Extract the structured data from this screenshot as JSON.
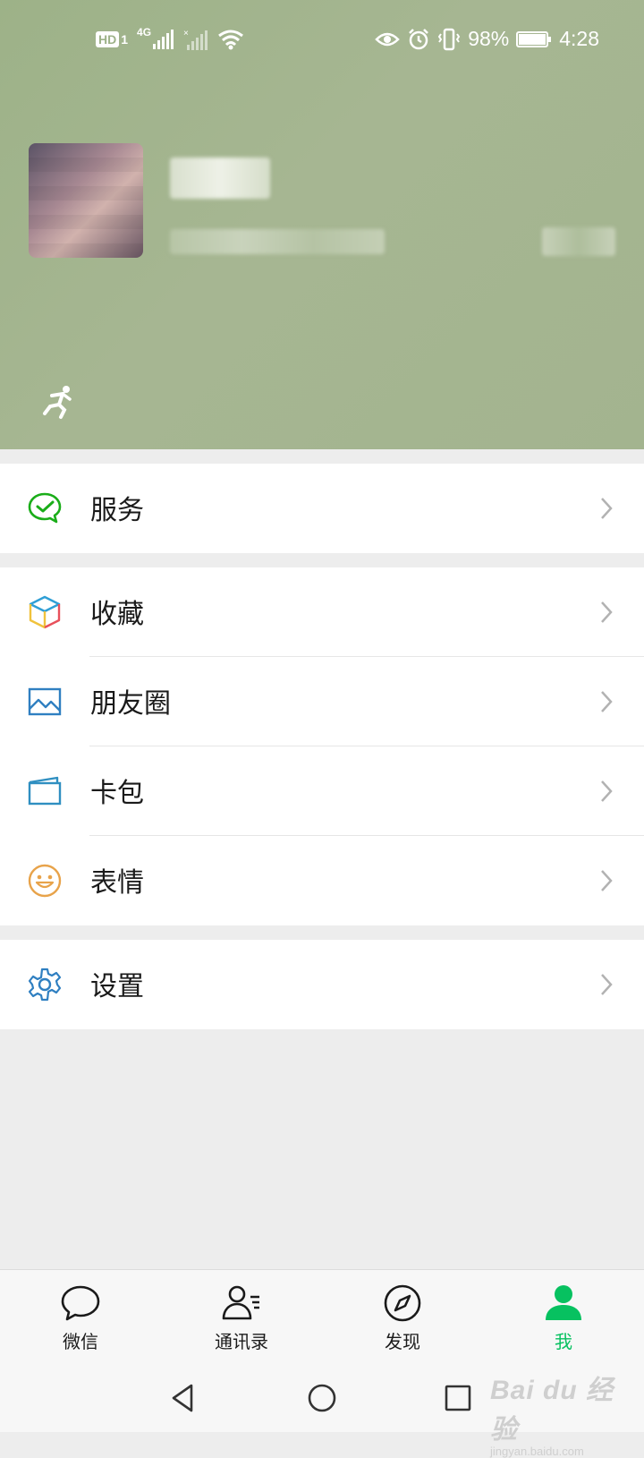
{
  "status_bar": {
    "hd_badge": "HD",
    "sim_slot": "1",
    "network": "4G",
    "battery_percent": "98%",
    "time": "4:28",
    "icons": [
      "eye-icon",
      "alarm-icon",
      "vibrate-icon",
      "battery-icon",
      "wifi-icon",
      "signal-icon"
    ]
  },
  "profile": {
    "avatar": "avatar",
    "status_icon": "running-man-icon"
  },
  "menu_groups": [
    {
      "items": [
        {
          "label": "服务",
          "icon": "service-icon"
        }
      ]
    },
    {
      "items": [
        {
          "label": "收藏",
          "icon": "favorites-cube-icon"
        },
        {
          "label": "朋友圈",
          "icon": "moments-picture-icon"
        },
        {
          "label": "卡包",
          "icon": "card-wallet-icon"
        },
        {
          "label": "表情",
          "icon": "smiley-icon"
        }
      ]
    },
    {
      "items": [
        {
          "label": "设置",
          "icon": "gear-icon"
        }
      ]
    }
  ],
  "tabbar": {
    "tabs": [
      {
        "label": "微信",
        "icon": "chat-bubble-icon",
        "active": false
      },
      {
        "label": "通讯录",
        "icon": "contacts-icon",
        "active": false
      },
      {
        "label": "发现",
        "icon": "compass-icon",
        "active": false
      },
      {
        "label": "我",
        "icon": "person-icon",
        "active": true
      }
    ],
    "active_color": "#07c160"
  },
  "colors": {
    "header_bg": "#a3b48f",
    "accent_green": "#07c160",
    "service_green": "#1aad19",
    "moments_blue": "#2f7fc1",
    "smiley_orange": "#e8a34a",
    "page_bg": "#ededed"
  },
  "watermark": {
    "main": "Bai du 经验",
    "sub": "jingyan.baidu.com"
  }
}
